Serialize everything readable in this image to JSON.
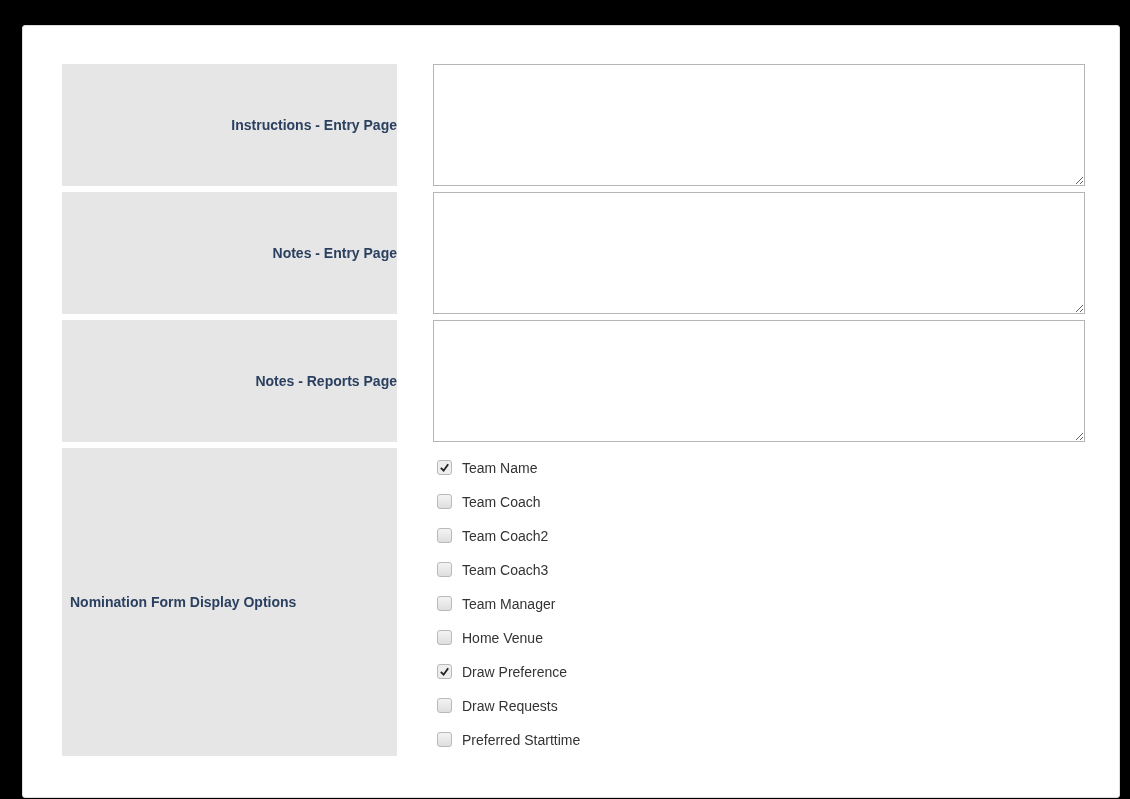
{
  "form": {
    "rows": [
      {
        "label": "Instructions - Entry Page",
        "kind": "textarea"
      },
      {
        "label": "Notes - Entry Page",
        "kind": "textarea"
      },
      {
        "label": "Notes - Reports Page",
        "kind": "textarea"
      },
      {
        "label": "Nomination Form Display Options",
        "kind": "checklist",
        "options": [
          {
            "label": "Team Name",
            "checked": true
          },
          {
            "label": "Team Coach",
            "checked": false
          },
          {
            "label": "Team Coach2",
            "checked": false
          },
          {
            "label": "Team Coach3",
            "checked": false
          },
          {
            "label": "Team Manager",
            "checked": false
          },
          {
            "label": "Home Venue",
            "checked": false
          },
          {
            "label": "Draw Preference",
            "checked": true
          },
          {
            "label": "Draw Requests",
            "checked": false
          },
          {
            "label": "Preferred Starttime",
            "checked": false
          }
        ]
      }
    ]
  }
}
